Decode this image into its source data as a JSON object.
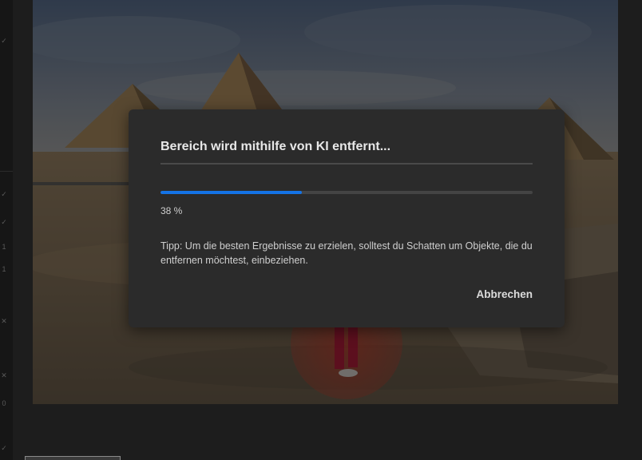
{
  "dialog": {
    "title": "Bereich wird mithilfe von KI entfernt...",
    "progress": 0.38,
    "progress_label": "38 %",
    "tip": "Tipp: Um die besten Ergebnisse zu erzielen, solltest du Schatten um Objekte, die du entfernen möchtest, einbeziehen.",
    "cancel_label": "Abbrechen"
  },
  "left_strip": {
    "marks": [
      "✓",
      "✓",
      "✓",
      "1",
      "1",
      "✕",
      "✕",
      "0",
      "✓"
    ]
  },
  "colors": {
    "accent": "#1473e6",
    "dialog_bg": "#2b2b2b",
    "app_bg": "#1d1d1d"
  }
}
